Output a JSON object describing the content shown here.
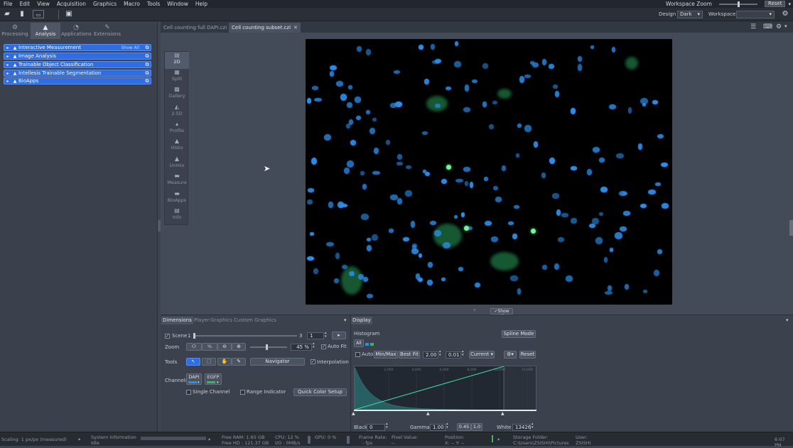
{
  "menu": [
    "File",
    "Edit",
    "View",
    "Acquisition",
    "Graphics",
    "Macro",
    "Tools",
    "Window",
    "Help"
  ],
  "workspace_zoom": {
    "label": "Workspace Zoom",
    "reset": "Reset"
  },
  "toolbar": {
    "design_label": "Design",
    "design_value": "Dark",
    "workspace_label": "Workspace"
  },
  "left_tabs": [
    {
      "label": "Processing",
      "icon": "gear-icon"
    },
    {
      "label": "Analysis",
      "icon": "analysis-icon"
    },
    {
      "label": "Applications",
      "icon": "applications-icon"
    },
    {
      "label": "Extensions",
      "icon": "wrench-icon"
    }
  ],
  "tools": [
    "Interactive Measurement",
    "Image Analysis",
    "Trainable Object Classification",
    "Intellesis Trainable Segmentation",
    "BioApps"
  ],
  "show_all": "Show All",
  "doc_tabs": [
    "Cell counting full DAPI.czi",
    "Cell counting subset.czi"
  ],
  "view_tabs": [
    "2D",
    "Split",
    "Gallery",
    "2.5D",
    "Profile",
    "Histo",
    "Unmix",
    "Measure",
    "BioApps",
    "Info"
  ],
  "image_show_all": "Show All",
  "bottom_tabs_left": [
    "Dimensions",
    "Player",
    "Graphics",
    "Custom Graphics"
  ],
  "bottom_tabs_right": [
    "Display"
  ],
  "dimensions": {
    "scene_label": "Scene",
    "scene_min": "1",
    "scene_max": "3",
    "scene_value": "1",
    "zoom_label": "Zoom",
    "zoom_value": "45 %",
    "auto_fit": "Auto Fit",
    "tools_label": "Tools",
    "navigator": "Navigator",
    "interpolation": "Interpolation",
    "channels_label": "Channels",
    "ch1": "DAPI",
    "ch2": "EGFP",
    "single_channel": "Single Channel",
    "range_indicator": "Range Indicator",
    "quick_color": "Quick Color Setup"
  },
  "display": {
    "histogram": "Histogram",
    "spline_mode": "Spline Mode",
    "all": "All",
    "auto": "Auto",
    "minmax": "Min/Max",
    "bestfit": "Best Fit",
    "v1": "2.00",
    "v2": "0.01",
    "current": "Current",
    "reset": "Reset",
    "black_label": "Black",
    "black_value": "0",
    "gamma_label": "Gamma",
    "gamma_value": "1.00",
    "g2": "0.45",
    "g3": "1.0",
    "white_label": "White",
    "white_value": "13426",
    "ticks": [
      "2,000",
      "4,000",
      "6,000",
      "8,000",
      "10,000",
      "12,000"
    ]
  },
  "status": {
    "scaling": "Scaling: 1 px/px (measured)",
    "sysinfo_label": "System Information",
    "sysinfo_value": "Idle",
    "free_ram": "Free RAM: 1.65 GB",
    "free_hd": "Free HD : 121.37 GB",
    "cpu": "CPU: 12 %",
    "io": "I/O : 0MB/s",
    "gpu": "GPU: 0 %",
    "frame_rate_label": "Frame Rate:",
    "frame_rate": "- fps",
    "pixel_value_label": "Pixel Value:",
    "pixel_value": "--",
    "position_label": "Position:",
    "position": "X: -- Y: --",
    "storage_label": "Storage Folder:",
    "storage": "C:\\Users\\ZSISHI\\Pictures",
    "user_label": "User:",
    "user": "ZSISHI",
    "time": "6:07 PM"
  },
  "colors": {
    "accent": "#2f6de0",
    "dapi": "#2e8fe8",
    "egfp": "#29a05a"
  }
}
